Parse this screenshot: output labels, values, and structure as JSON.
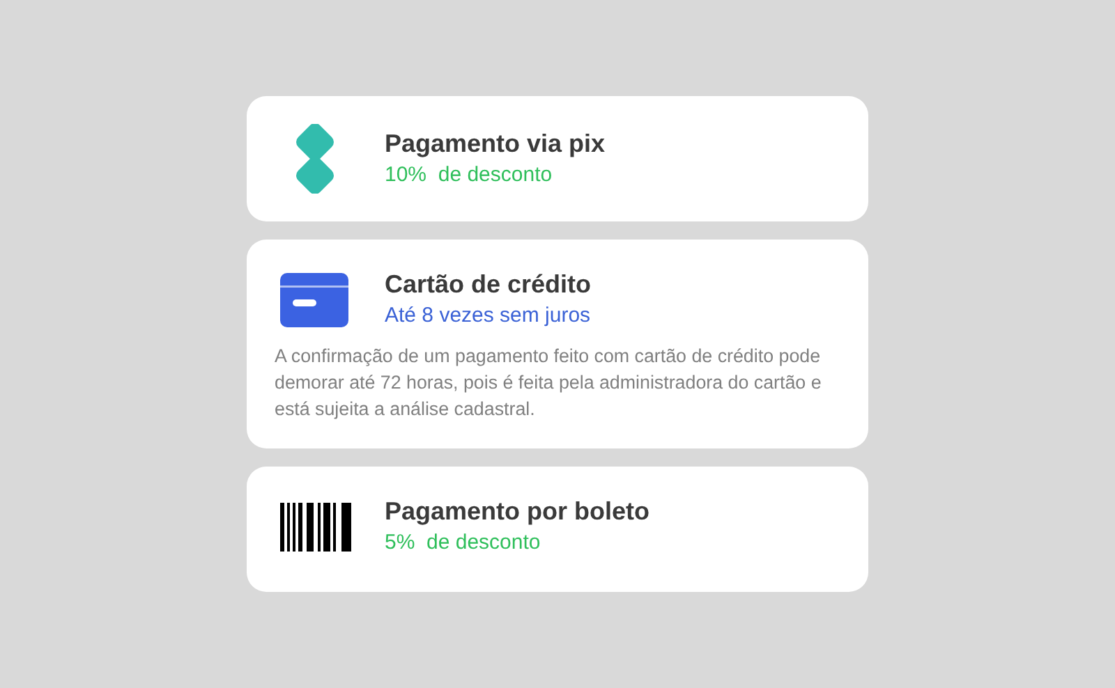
{
  "payment_options": [
    {
      "kind": "pix",
      "title": "Pagamento via pix",
      "subtitle": "10%  de desconto",
      "color": "#2fbf5b"
    },
    {
      "kind": "card",
      "title": "Cartão de crédito",
      "subtitle": "Até 8 vezes sem juros",
      "color": "#3b62d6",
      "note": "A confirmação de um pagamento feito com cartão de crédito pode demorar até 72 horas, pois é feita pela administradora do cartão e está sujeita a análise cadastral."
    },
    {
      "kind": "barcode",
      "title": "Pagamento por boleto",
      "subtitle": "5%  de desconto",
      "color": "#2fbf5b"
    }
  ]
}
